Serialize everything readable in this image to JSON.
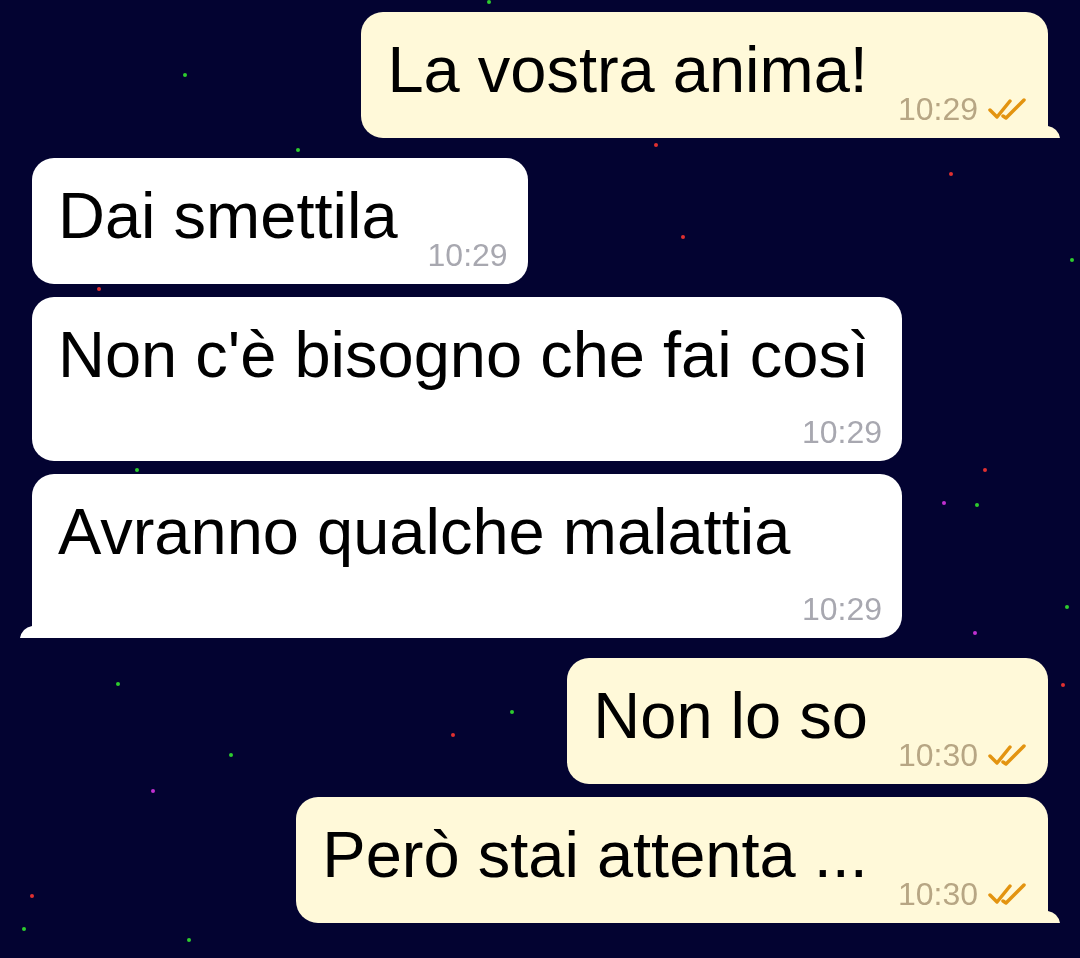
{
  "messages": [
    {
      "kind": "outgoing",
      "text": "La vostra anima!",
      "time": "10:29",
      "read": true,
      "tail": true
    },
    {
      "kind": "incoming",
      "text": "Dai smettila",
      "time": "10:29",
      "tail": false
    },
    {
      "kind": "incoming",
      "text": "Non c'è bisogno che fai così",
      "time": "10:29",
      "tail": false
    },
    {
      "kind": "incoming",
      "text": "Avranno qualche malattia",
      "time": "10:29",
      "tail": true
    },
    {
      "kind": "outgoing",
      "text": "Non lo so",
      "time": "10:30",
      "read": true,
      "tail": false
    },
    {
      "kind": "outgoing",
      "text": "Però stai attenta ...",
      "time": "10:30",
      "read": true,
      "tail": true
    }
  ]
}
